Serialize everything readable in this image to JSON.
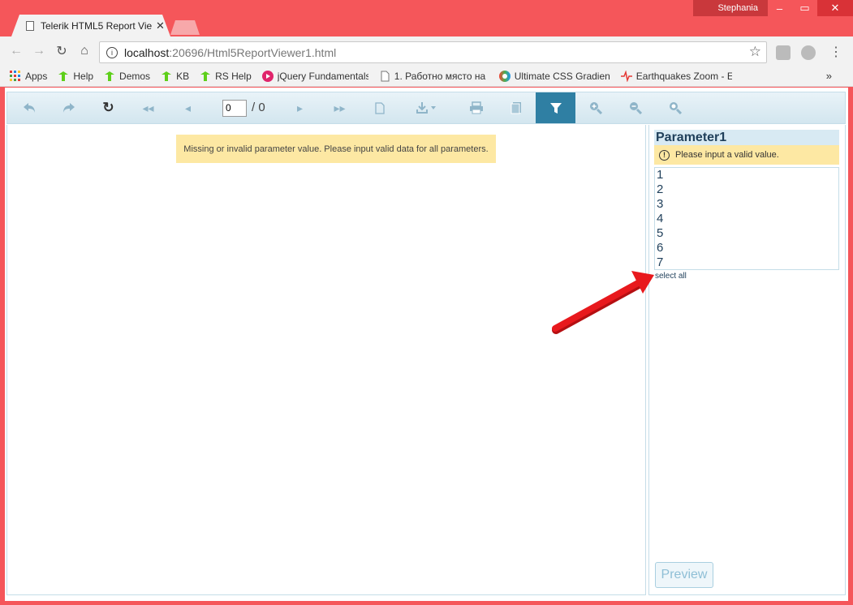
{
  "browser": {
    "tab_title": "Telerik HTML5 Report Vie",
    "user_name": "Stephania",
    "url_host": "localhost",
    "url_path": ":20696/Html5ReportViewer1.html",
    "bookmarks": [
      {
        "label": "Apps",
        "icon": "apps-grid-icon",
        "color": "#4caf50"
      },
      {
        "label": "Help",
        "icon": "telerik-icon",
        "color": "#5ecf1a"
      },
      {
        "label": "Demos",
        "icon": "telerik-icon",
        "color": "#5ecf1a"
      },
      {
        "label": "KB",
        "icon": "telerik-icon",
        "color": "#5ecf1a"
      },
      {
        "label": "RS Help",
        "icon": "telerik-icon",
        "color": "#5ecf1a"
      },
      {
        "label": "jQuery Fundamentals",
        "icon": "pluralsight-icon",
        "color": "#e0246b"
      },
      {
        "label": "1. Работно място на",
        "icon": "document-icon",
        "color": "#777777"
      },
      {
        "label": "Ultimate CSS Gradient",
        "icon": "gradient-icon",
        "color": "#9c27b0"
      },
      {
        "label": "Earthquakes Zoom - E",
        "icon": "pulse-icon",
        "color": "#e53935"
      }
    ]
  },
  "viewer": {
    "page_number": "0",
    "page_total": "/ 0",
    "warning": "Missing or invalid parameter value. Please input valid data for all parameters."
  },
  "parameters": {
    "title": "Parameter1",
    "error": "Please input a valid value.",
    "options": [
      "1",
      "2",
      "3",
      "4",
      "5",
      "6",
      "7"
    ],
    "select_all": "select all",
    "preview_label": "Preview"
  }
}
